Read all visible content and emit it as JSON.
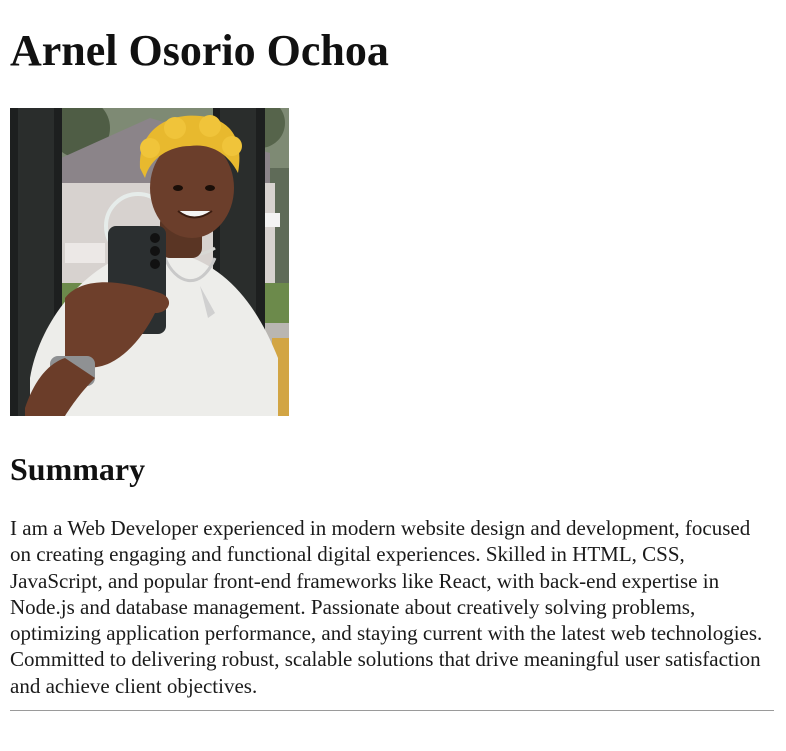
{
  "profile": {
    "name": "Arnel Osorio Ochoa",
    "photo_icon": "profile-photo"
  },
  "summary": {
    "heading": "Summary",
    "text": "I am a Web Developer experienced in modern website design and development, focused on creating engaging and functional digital experiences. Skilled in HTML, CSS, JavaScript, and popular front-end frameworks like React, with back-end expertise in Node.js and database management. Passionate about creatively solving problems, optimizing application performance, and staying current with the latest web technologies. Committed to delivering robust, scalable solutions that drive meaningful user satisfaction and achieve client objectives."
  },
  "colors": {
    "text": "#111111",
    "divider": "#9a9a9a",
    "hair": "#e8b92e"
  }
}
